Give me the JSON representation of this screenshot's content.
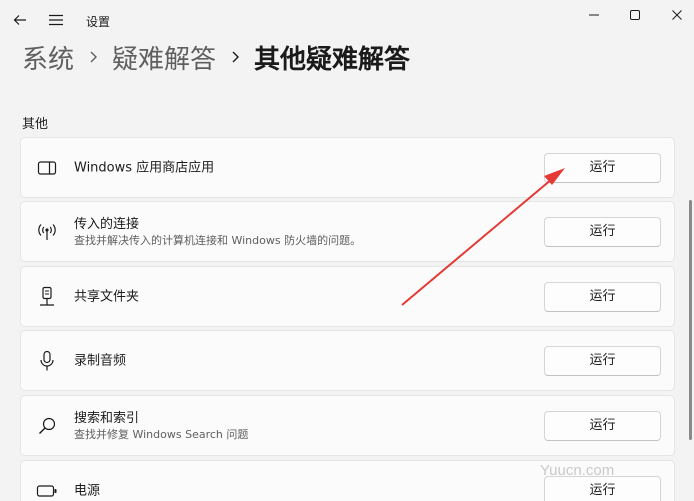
{
  "window": {
    "title": "设置"
  },
  "breadcrumb": {
    "items": [
      "系统",
      "疑难解答",
      "其他疑难解答"
    ]
  },
  "section": {
    "label": "其他"
  },
  "items": [
    {
      "title": "Windows 应用商店应用",
      "desc": "",
      "button": "运行",
      "icon": "tablet-app-icon"
    },
    {
      "title": "传入的连接",
      "desc": "查找并解决传入的计算机连接和 Windows 防火墙的问题。",
      "button": "运行",
      "icon": "broadcast-icon"
    },
    {
      "title": "共享文件夹",
      "desc": "",
      "button": "运行",
      "icon": "network-folder-icon"
    },
    {
      "title": "录制音频",
      "desc": "",
      "button": "运行",
      "icon": "microphone-icon"
    },
    {
      "title": "搜索和索引",
      "desc": "查找并修复 Windows Search 问题",
      "button": "运行",
      "icon": "search-icon"
    },
    {
      "title": "电源",
      "desc": "",
      "button": "运行",
      "icon": "battery-icon"
    }
  ],
  "watermark": "Yuucn.com",
  "colors": {
    "annotation_arrow": "#e53935",
    "background": "#f3f3f3",
    "card": "#fbfbfb"
  }
}
